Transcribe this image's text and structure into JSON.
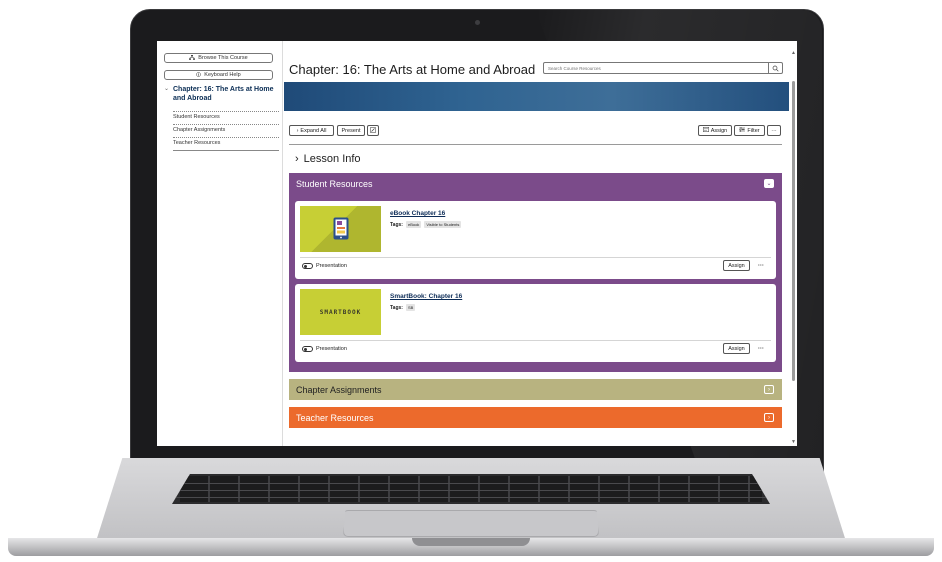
{
  "nav": {
    "browse_label": "Browse This Course",
    "keyboard_label": "Keyboard Help",
    "chapter_label": "Chapter: 16: The Arts at Home and Abroad",
    "links": [
      "Student Resources",
      "Chapter Assignments",
      "Teacher Resources"
    ]
  },
  "header": {
    "title": "Chapter: 16: The Arts at Home and Abroad",
    "search_placeholder": "Search Course Resources"
  },
  "toolbar": {
    "expand_label": "Expand All",
    "present_label": "Present",
    "assign_label": "Assign",
    "filter_label": "Filter",
    "more_label": "···"
  },
  "lesson_info": "Lesson Info",
  "sections": {
    "student": "Student Resources",
    "chapter_assignments": "Chapter Assignments",
    "teacher": "Teacher Resources"
  },
  "cards": [
    {
      "title": "eBook Chapter 16",
      "tags_label": "Tags:",
      "tags": [
        "eBook",
        "Visible to Students"
      ],
      "presentation_label": "Presentation",
      "assign_label": "Assign",
      "more_label": "···"
    },
    {
      "title": "SmartBook: Chapter 16",
      "tags_label": "Tags:",
      "tags": [
        "SB"
      ],
      "thumb_text": "SMARTBOOK",
      "presentation_label": "Presentation",
      "assign_label": "Assign",
      "more_label": "···"
    }
  ],
  "colors": {
    "student_section": "#7b4b8a",
    "chapter_assignments_section": "#b8b380",
    "teacher_section": "#ec6a2c",
    "thumbnail": "#c7cf35",
    "banner": "#2f6391"
  }
}
